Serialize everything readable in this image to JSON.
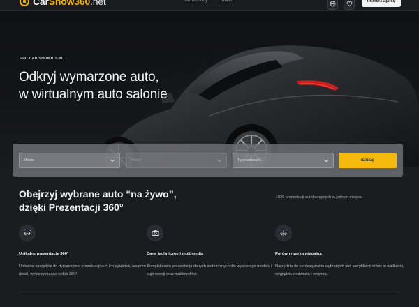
{
  "header": {
    "logo": {
      "prefix": "Car",
      "accent": "Show360",
      "tld": ".net"
    },
    "nav": [
      "samochody",
      "marki"
    ],
    "buttons": [
      "globe-icon",
      "heart-icon"
    ],
    "cta_label": "Pobierz aplikę"
  },
  "hero": {
    "kicker": "360° CAR SHOWROOM",
    "title_line1": "Odkryj wymarzone auto,",
    "title_line2": "w wirtualnym auto salonie"
  },
  "search": {
    "brand_placeholder": "Marka",
    "model_placeholder": "Model",
    "body_placeholder": "Typ nadwozia",
    "button_label": "Szukaj"
  },
  "intro": {
    "title_line1": "Obejrzyj wybrane auto “na żywo”,",
    "title_line2": "dzięki Prezentacji 360°",
    "count_text": "1026 prezentacji aut dostępnych w jednym miejscu"
  },
  "features": [
    {
      "icon": "car-360-icon",
      "title": "Unikalne prezentacje 360°",
      "desc": "Unikalne narzędzie do dynamicznej prezentacji aut, ich sylwetek, wnętrza i detali, wykorzystujące widok 360°."
    },
    {
      "icon": "camera-icon",
      "title": "Dane techniczne i multimedia",
      "desc": "Kompleksowa prezentacja danych technicznych dla wybranego modelu i jego wersji oraz multimediów."
    },
    {
      "icon": "compare-car-icon",
      "title": "Porównywarka wizualna",
      "desc": "Narzędzie do porównywania wybranych aut, weryfikacji różnic w wielkości, wyglądzie nadwozia i wnętrza."
    }
  ],
  "colors": {
    "accent": "#f4b90c",
    "background": "#1b1c20"
  }
}
